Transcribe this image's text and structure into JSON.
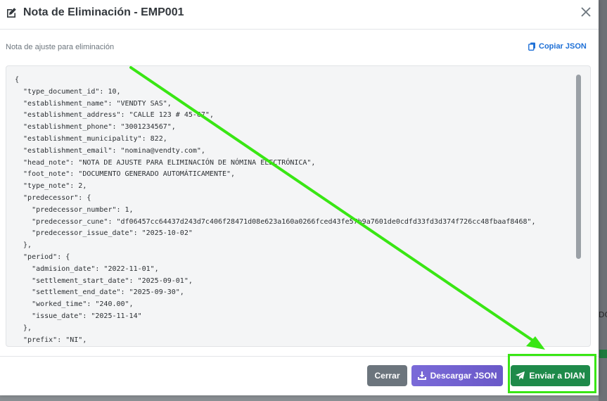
{
  "modal": {
    "title": "Nota de Eliminación - EMP001",
    "subtitle": "Nota de ajuste para eliminación",
    "copy_label": "Copiar JSON",
    "json_lines": [
      "{",
      "  \"type_document_id\": 10,",
      "  \"establishment_name\": \"VENDTY SAS\",",
      "  \"establishment_address\": \"CALLE 123 # 45-67\",",
      "  \"establishment_phone\": \"3001234567\",",
      "  \"establishment_municipality\": 822,",
      "  \"establishment_email\": \"nomina@vendty.com\",",
      "  \"head_note\": \"NOTA DE AJUSTE PARA ELIMINACIÓN DE NÓMINA ELECTRÓNICA\",",
      "  \"foot_note\": \"DOCUMENTO GENERADO AUTOMÁTICAMENTE\",",
      "  \"type_note\": 2,",
      "  \"predecessor\": {",
      "    \"predecessor_number\": 1,",
      "    \"predecessor_cune\": \"df06457cc64437d243d7c406f28471d08e623a160a0266fced43fe57b9a7601de0cdfd33fd3d374f726cc48fbaaf8468\",",
      "    \"predecessor_issue_date\": \"2025-10-02\"",
      "  },",
      "  \"period\": {",
      "    \"admision_date\": \"2022-11-01\",",
      "    \"settlement_start_date\": \"2025-09-01\",",
      "    \"settlement_end_date\": \"2025-09-30\",",
      "    \"worked_time\": \"240.00\",",
      "    \"issue_date\": \"2025-11-14\"",
      "  },",
      "  \"prefix\": \"NI\","
    ]
  },
  "footer": {
    "close_label": "Cerrar",
    "download_label": "Descargar JSON",
    "send_label": "Enviar a DIAN"
  },
  "backdrop": {
    "partial_text": "DC"
  },
  "colors": {
    "annotation": "#39e614",
    "send_button": "#1e8a4a",
    "download_button": "#6a59c8",
    "close_button": "#6c757d",
    "link": "#1d6fd6"
  },
  "icons": [
    "edit-icon",
    "close-icon",
    "copy-icon",
    "download-icon",
    "send-icon"
  ]
}
